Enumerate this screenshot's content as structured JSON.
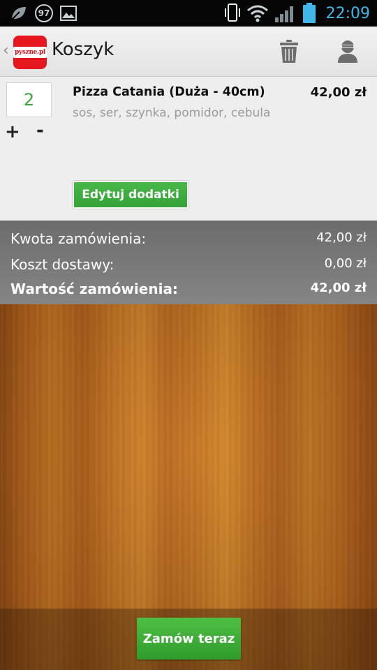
{
  "statusbar": {
    "notification_count": "97",
    "time": "22:09"
  },
  "actionbar": {
    "logo_text": "pyszne.pl",
    "title": "Koszyk"
  },
  "cart": {
    "items": [
      {
        "quantity": "2",
        "plus_label": "+",
        "minus_label": "-",
        "name": "Pizza Catania (Duża - 40cm)",
        "description": "sos, ser, szynka, pomidor, cebula",
        "price": "42,00 zł",
        "edit_label": "Edytuj dodatki"
      }
    ]
  },
  "summary": {
    "subtotal_label": "Kwota zamówienia:",
    "subtotal_value": "42,00 zł",
    "delivery_label": "Koszt dostawy:",
    "delivery_value": "0,00 zł",
    "total_label": "Wartość zamówienia:",
    "total_value": "42,00 zł"
  },
  "footer": {
    "order_label": "Zamów teraz"
  },
  "colors": {
    "accent_green": "#3aa63a",
    "time_blue": "#3fb7e8",
    "brand_red": "#e4161e"
  }
}
